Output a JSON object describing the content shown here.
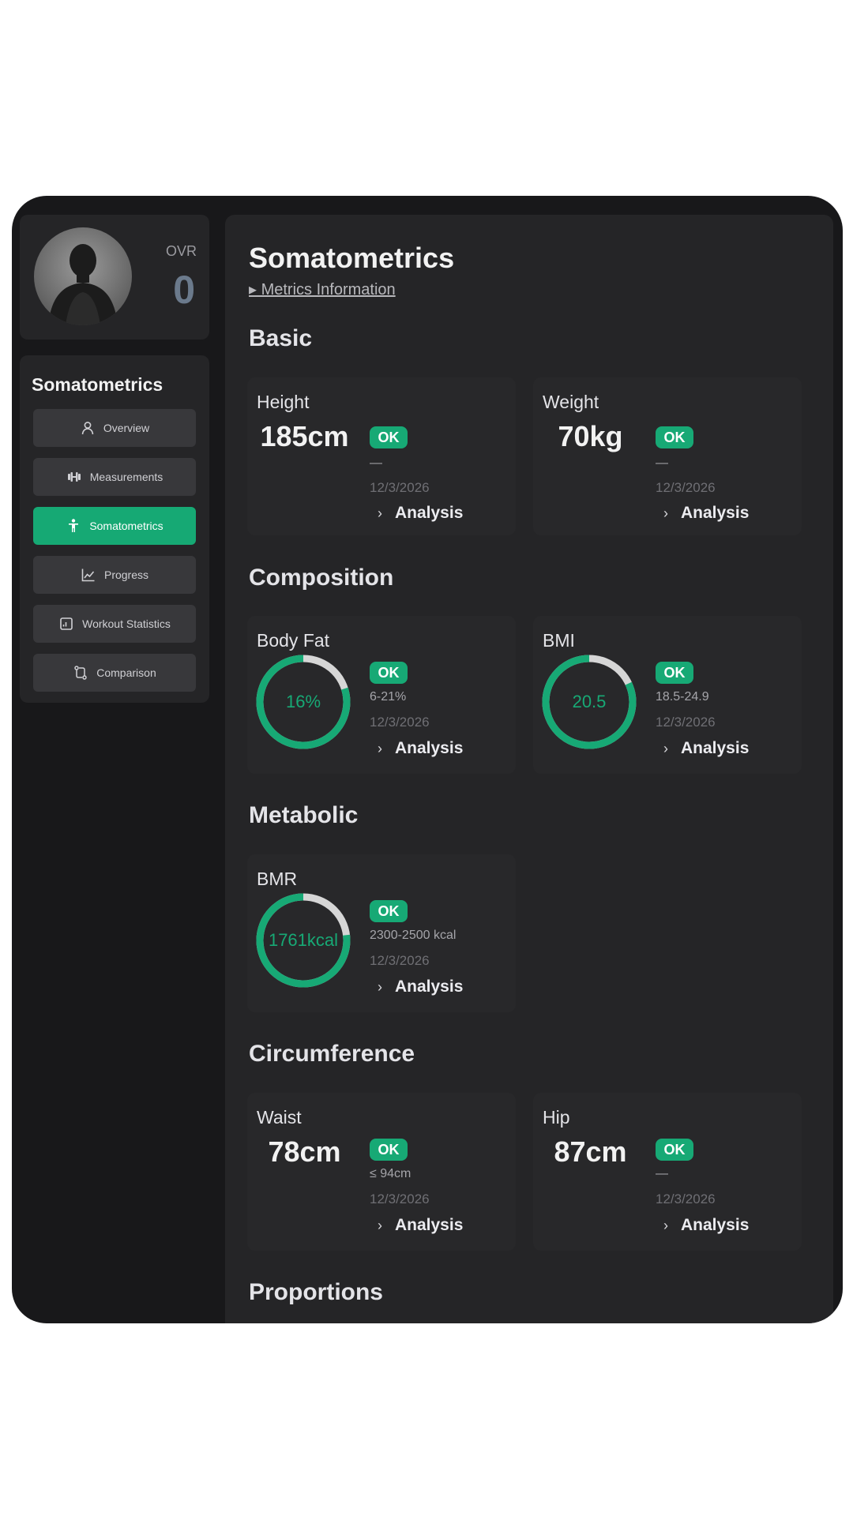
{
  "profile": {
    "ovr_label": "OVR",
    "ovr_value": "0"
  },
  "sidebar": {
    "title": "Somatometrics",
    "items": [
      {
        "label": "Overview",
        "icon": "person-icon",
        "active": false
      },
      {
        "label": "Measurements",
        "icon": "dumbbell-icon",
        "active": false
      },
      {
        "label": "Somatometrics",
        "icon": "body-icon",
        "active": true
      },
      {
        "label": "Progress",
        "icon": "line-chart-icon",
        "active": false
      },
      {
        "label": "Workout Statistics",
        "icon": "stats-icon",
        "active": false
      },
      {
        "label": "Comparison",
        "icon": "compare-icon",
        "active": false
      }
    ]
  },
  "main": {
    "title": "Somatometrics",
    "info_link": "▸ Metrics Information",
    "analysis_label": "Analysis",
    "ok_label": "OK",
    "sections": {
      "basic": "Basic",
      "composition": "Composition",
      "metabolic": "Metabolic",
      "circumference": "Circumference",
      "proportions": "Proportions"
    },
    "metrics": {
      "height": {
        "name": "Height",
        "value": "185cm",
        "range": "—",
        "date": "12/3/2026"
      },
      "weight": {
        "name": "Weight",
        "value": "70kg",
        "range": "—",
        "date": "12/3/2026"
      },
      "body_fat": {
        "name": "Body Fat",
        "value": "16%",
        "range": "6-21%",
        "date": "12/3/2026",
        "ring_fraction": 0.8
      },
      "bmi": {
        "name": "BMI",
        "value": "20.5",
        "range": "18.5-24.9",
        "date": "12/3/2026",
        "ring_fraction": 0.82
      },
      "bmr": {
        "name": "BMR",
        "value": "1761kcal",
        "range": "2300-2500 kcal",
        "date": "12/3/2026",
        "ring_fraction": 0.77
      },
      "waist": {
        "name": "Waist",
        "value": "78cm",
        "range": "≤ 94cm",
        "date": "12/3/2026"
      },
      "hip": {
        "name": "Hip",
        "value": "87cm",
        "range": "—",
        "date": "12/3/2026"
      }
    }
  },
  "colors": {
    "accent": "#17a975",
    "ring_track": "#d6d6d6",
    "panel": "#252527",
    "frame": "#18181a"
  }
}
